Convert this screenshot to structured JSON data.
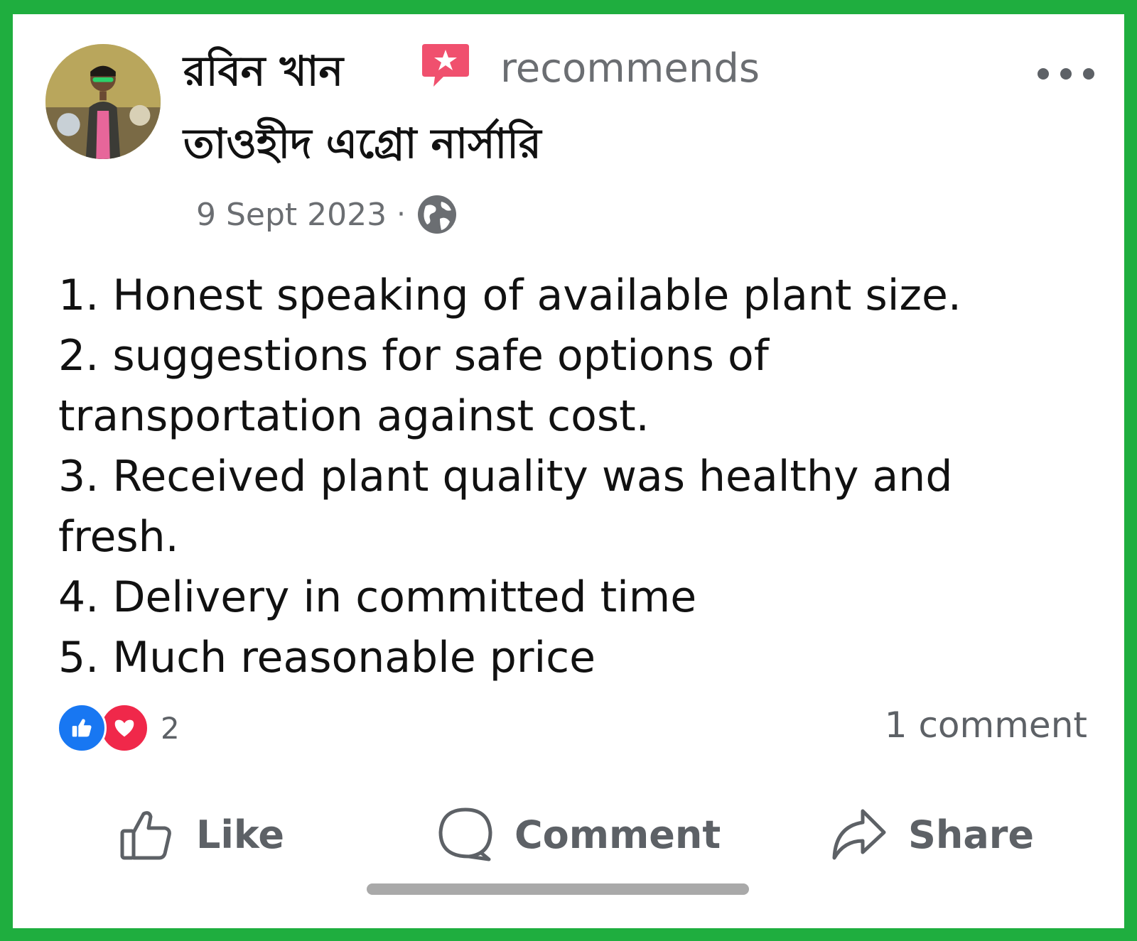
{
  "post": {
    "author": "রবিন খান",
    "recommend_text": "recommends",
    "page_name": "তাওহীদ এগ্রো নার্সারি",
    "date": "9 Sept 2023",
    "separator": "·",
    "privacy_icon": "globe-icon",
    "lines": [
      "1. Honest speaking of available plant size.",
      "2. suggestions for safe options of",
      "transportation against cost.",
      "3. Received plant quality was healthy and",
      "fresh.",
      "4. Delivery in committed time",
      "5. Much reasonable price"
    ]
  },
  "reactions": {
    "icons": [
      "like-icon",
      "love-icon"
    ],
    "count": "2"
  },
  "comments": {
    "count_label": "1 comment"
  },
  "actions": {
    "like": "Like",
    "comment": "Comment",
    "share": "Share"
  },
  "colors": {
    "border": "#1fae3f",
    "like_blue": "#1877f2",
    "love_red": "#f0284a",
    "badge_pink": "#f0506e",
    "muted_text": "#6b6e72"
  }
}
